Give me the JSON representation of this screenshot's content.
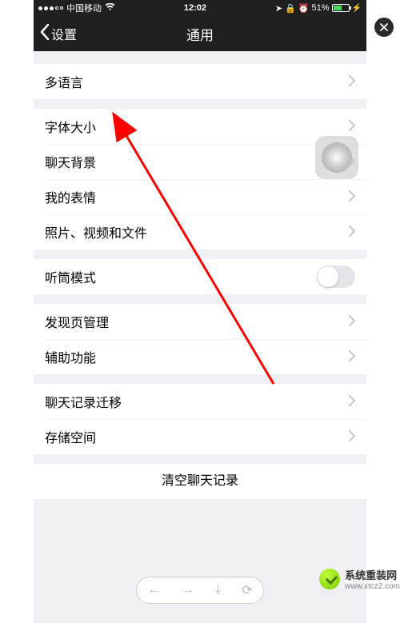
{
  "status": {
    "carrier": "中国移动",
    "time": "12:02",
    "battery_pct": "51%"
  },
  "nav": {
    "back_label": "设置",
    "title": "通用"
  },
  "groups": [
    {
      "cells": [
        {
          "label": "多语言",
          "chevron": true
        }
      ]
    },
    {
      "cells": [
        {
          "label": "字体大小",
          "chevron": true
        },
        {
          "label": "聊天背景",
          "chevron": true
        },
        {
          "label": "我的表情",
          "chevron": true
        },
        {
          "label": "照片、视频和文件",
          "chevron": true
        }
      ]
    },
    {
      "cells": [
        {
          "label": "听筒模式",
          "switch": true,
          "switch_on": false
        }
      ]
    },
    {
      "cells": [
        {
          "label": "发现页管理",
          "chevron": true
        },
        {
          "label": "辅助功能",
          "chevron": true
        }
      ]
    },
    {
      "cells": [
        {
          "label": "聊天记录迁移",
          "chevron": true
        },
        {
          "label": "存储空间",
          "chevron": true
        }
      ]
    }
  ],
  "clear_button": "清空聊天记录",
  "watermark": {
    "title": "系统重装网",
    "sub": "www.xtcz2.com"
  }
}
